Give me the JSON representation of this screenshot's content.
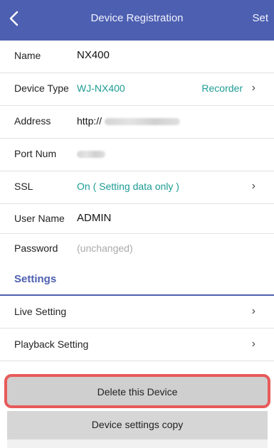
{
  "header": {
    "title": "Device Registration",
    "set_label": "Set"
  },
  "fields": {
    "name": {
      "label": "Name",
      "value": "NX400"
    },
    "device_type": {
      "label": "Device Type",
      "value": "WJ-NX400",
      "right": "Recorder"
    },
    "address": {
      "label": "Address",
      "prefix": "http://"
    },
    "port": {
      "label": "Port Num"
    },
    "ssl": {
      "label": "SSL",
      "value": "On ( Setting data only )"
    },
    "user": {
      "label": "User Name",
      "value": "ADMIN"
    },
    "password": {
      "label": "Password",
      "value": "(unchanged)"
    }
  },
  "settings": {
    "heading": "Settings",
    "live": "Live Setting",
    "playback": "Playback Setting"
  },
  "buttons": {
    "delete": "Delete this Device",
    "copy": "Device settings copy"
  },
  "colors": {
    "header": "#4d5fb0",
    "teal_value": "#1d9c94",
    "highlight": "#e85a5a"
  },
  "icons": {
    "back": "back-icon",
    "chevron": "chevron-right-icon"
  }
}
